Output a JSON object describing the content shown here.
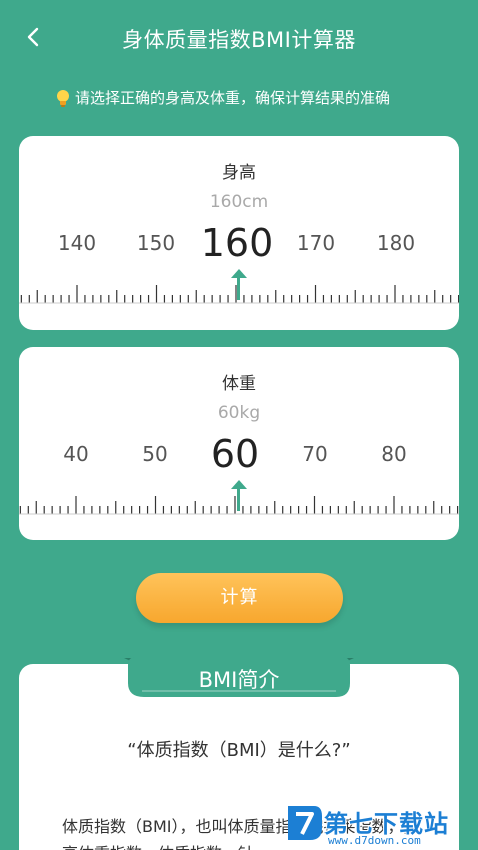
{
  "header": {
    "title": "身体质量指数BMI计算器",
    "back_icon": "chevron-left-icon"
  },
  "tip": {
    "icon": "lightbulb-icon",
    "text": "请选择正确的身高及体重，确保计算结果的准确"
  },
  "height": {
    "label": "身高",
    "value_text": "160cm",
    "selected": "160",
    "scale_left": [
      "140",
      "150"
    ],
    "scale_right": [
      "170",
      "180"
    ]
  },
  "weight": {
    "label": "体重",
    "value_text": "60kg",
    "selected": "60",
    "scale_left": [
      "40",
      "50"
    ],
    "scale_right": [
      "70",
      "80"
    ]
  },
  "calculate_button": {
    "label": "计算"
  },
  "info": {
    "ribbon_title": "BMI简介",
    "question": "“体质指数（BMI）是什么?”",
    "body": "体质指数（BMI），也叫体质量指数完托莱指数，身高体重指数，体质指数，针"
  },
  "watermark": {
    "text": "第七下载站",
    "url": "www.d7down.com"
  },
  "colors": {
    "background": "#3fa98c",
    "accent": "#3fa98c",
    "button": "#f7a72e"
  }
}
